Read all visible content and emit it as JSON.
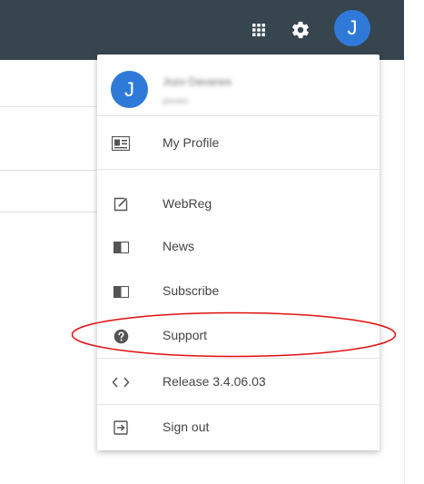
{
  "topbar": {
    "apps_icon": "apps-grid-icon",
    "settings_icon": "gear-icon",
    "avatar_initial": "J",
    "avatar_color": "#2f7ad9",
    "background": "#37454e"
  },
  "menu": {
    "header": {
      "avatar_initial": "J",
      "user_name": "Jozo Davanes",
      "user_email": "jesuion"
    },
    "items": [
      {
        "label": "My Profile",
        "icon": "profile-card-icon"
      },
      {
        "label": "WebReg",
        "icon": "edit-icon"
      },
      {
        "label": "News",
        "icon": "book-icon"
      },
      {
        "label": "Subscribe",
        "icon": "book-icon"
      },
      {
        "label": "Support",
        "icon": "help-icon"
      },
      {
        "label": "Release 3.4.06.03",
        "icon": "code-icon"
      },
      {
        "label": "Sign out",
        "icon": "sign-out-icon"
      }
    ]
  },
  "annotation": {
    "highlight_color": "#e01010"
  }
}
